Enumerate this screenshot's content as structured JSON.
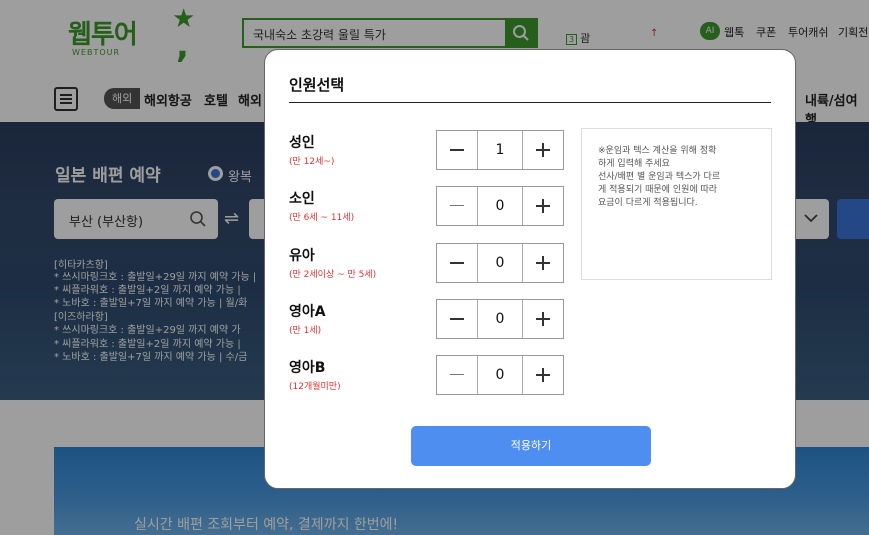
{
  "header": {
    "logo_text": "웹투어",
    "logo_sub": "WEBTOUR",
    "search_text": "국내숙소 초강력 울릴 특가",
    "rank_num": "3",
    "rank_text": "괌",
    "rank_trend": "↑",
    "ai_badge": "AI",
    "util_links": [
      "웹톡",
      "쿠폰",
      "투어캐쉬",
      "기획전"
    ],
    "overseas_badge": "해외",
    "gnb": [
      "해외항공",
      "호텔",
      "해외"
    ],
    "gnb_right": "내륙/섬여행"
  },
  "hero": {
    "title": "일본 배편 예약",
    "radio_label": "왕복",
    "departure": "부산 (부산항)",
    "notices": [
      "[히타카츠항]",
      "* 쓰시마링크호 : 출발일+29일 까지 예약 가능 |",
      "* 씨플라워호 : 출발일+2일 까지 예약 가능 |",
      "* 노바호 : 출발일+7일 까지 예약 가능 | 월/화",
      "[이즈하라항]",
      "* 쓰시마링크호 : 출발일+29일 까지 예약 가",
      "* 씨플라워호 : 출발일+2일 까지 예약 가능 |",
      "* 노바호 : 출발일+7일 까지 예약 가능 | 수/금"
    ],
    "banner_text": "실시간 배편 조회부터 예약, 결제까지 한번에!"
  },
  "modal": {
    "title": "인원선택",
    "passengers": [
      {
        "label": "성인",
        "age": "(만 12세~)",
        "count": "1"
      },
      {
        "label": "소인",
        "age": "(만 6세 ~ 11세)",
        "count": "0"
      },
      {
        "label": "유아",
        "age": "(만 2세이상 ~ 만 5세)",
        "count": "0"
      },
      {
        "label": "영아A",
        "age": "(만 1세)",
        "count": "0"
      },
      {
        "label": "영아B",
        "age": "(12개월미만)",
        "count": "0"
      }
    ],
    "info_lines": [
      "※운임과 텍스 계산을 위해 정확",
      "하게 입력해 주세요",
      "선사/배편 별 운임과 텍스가 다르",
      "게 적용되기 때문에 인원에 따라",
      "요금이 다르게 적용됩니다."
    ],
    "apply_label": "적용하기"
  },
  "colors": {
    "brand_green": "#3c9a2c",
    "apply_blue": "#4e8ef0",
    "age_red": "#d33333"
  }
}
